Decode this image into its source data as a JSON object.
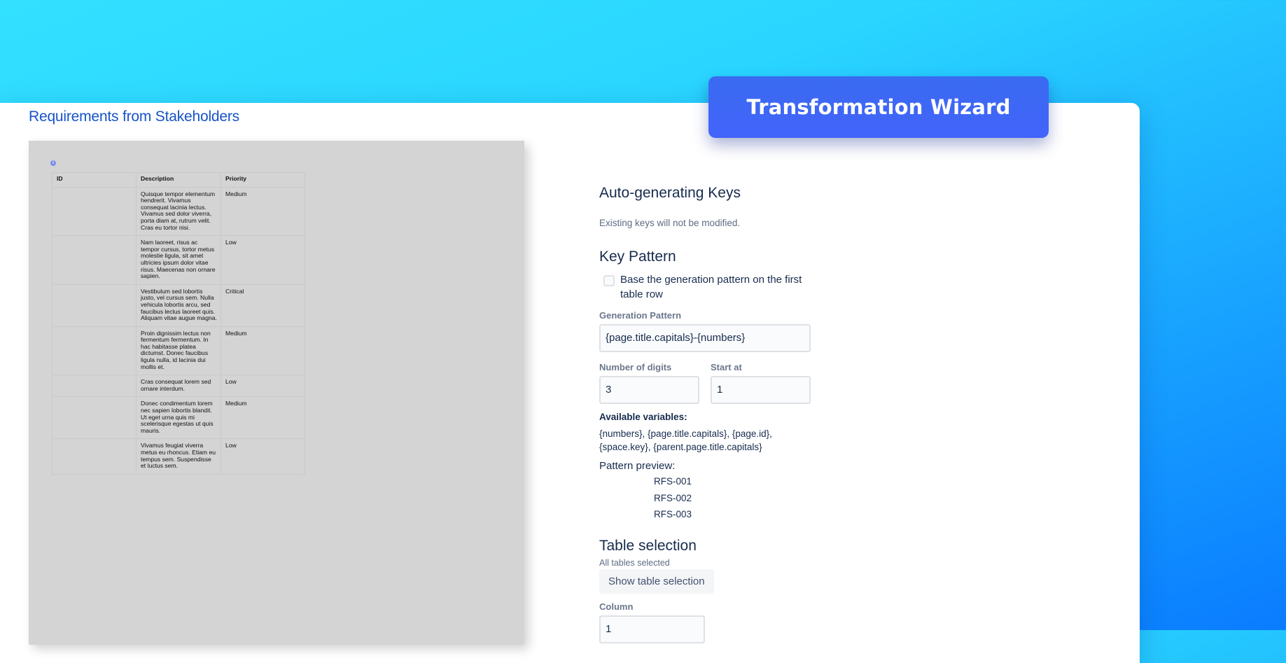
{
  "page_title": "Requirements from Stakeholders",
  "banner_title": "Transformation Wizard",
  "preview_table": {
    "info_icon": "info-icon",
    "headers": [
      "ID",
      "Description",
      "Priority"
    ],
    "rows": [
      {
        "id": "",
        "description": "Quisque tempor elementum hendrerit. Vivamus consequat lacinia lectus. Vivamus sed dolor viverra, porta diam at, rutrum velit. Cras eu tortor nisi.",
        "priority": "Medium"
      },
      {
        "id": "",
        "description": "Nam laoreet, risus ac tempor cursus, tortor metus molestie ligula, sit amet ultricies ipsum dolor vitae risus. Maecenas non ornare sapien.",
        "priority": "Low"
      },
      {
        "id": "",
        "description": "Vestibulum sed lobortis justo, vel cursus sem. Nulla vehicula lobortis arcu, sed faucibus lectus laoreet quis. Aliquam vitae augue magna.",
        "priority": "Critical"
      },
      {
        "id": "",
        "description": "Proin dignissim lectus non fermentum fermentum. In hac habitasse platea dictumst. Donec faucibus ligula nulla, id lacinia dui mollis et.",
        "priority": "Medium"
      },
      {
        "id": "",
        "description": "Cras consequat lorem sed ornare interdum.",
        "priority": "Low"
      },
      {
        "id": "",
        "description": "Donec condimentum lorem nec sapien lobortis blandit. Ut eget urna quis mi scelerisque egestas ut quis mauris.",
        "priority": "Medium"
      },
      {
        "id": "",
        "description": "Vivamus feugiat viverra metus eu rhoncus. Etiam eu tempus sem. Suspendisse et luctus sem.",
        "priority": "Low"
      }
    ]
  },
  "form": {
    "auto_title": "Auto-generating Keys",
    "auto_note": "Existing keys will not be modified.",
    "key_pattern_title": "Key Pattern",
    "base_checkbox_label": "Base the generation pattern on the first table row",
    "base_checkbox_checked": false,
    "generation_pattern_label": "Generation Pattern",
    "generation_pattern_value": "{page.title.capitals}-{numbers}",
    "digits_label": "Number of digits",
    "digits_value": "3",
    "start_label": "Start at",
    "start_value": "1",
    "vars_title": "Available variables:",
    "vars_text": "{numbers}, {page.title.capitals}, {page.id}, {space.key}, {parent.page.title.capitals}",
    "preview_title": "Pattern preview:",
    "preview_keys": [
      "RFS-001",
      "RFS-002",
      "RFS-003"
    ],
    "table_selection_title": "Table selection",
    "table_selection_note": "All tables selected",
    "show_table_button": "Show table selection",
    "column_label": "Column",
    "column_value": "1"
  },
  "colors": {
    "background_gradient_start": "#33e0ff",
    "background_gradient_end": "#0a7cff",
    "banner": "#4263fb",
    "page_title": "#1653c8",
    "text": "#172b4d"
  }
}
